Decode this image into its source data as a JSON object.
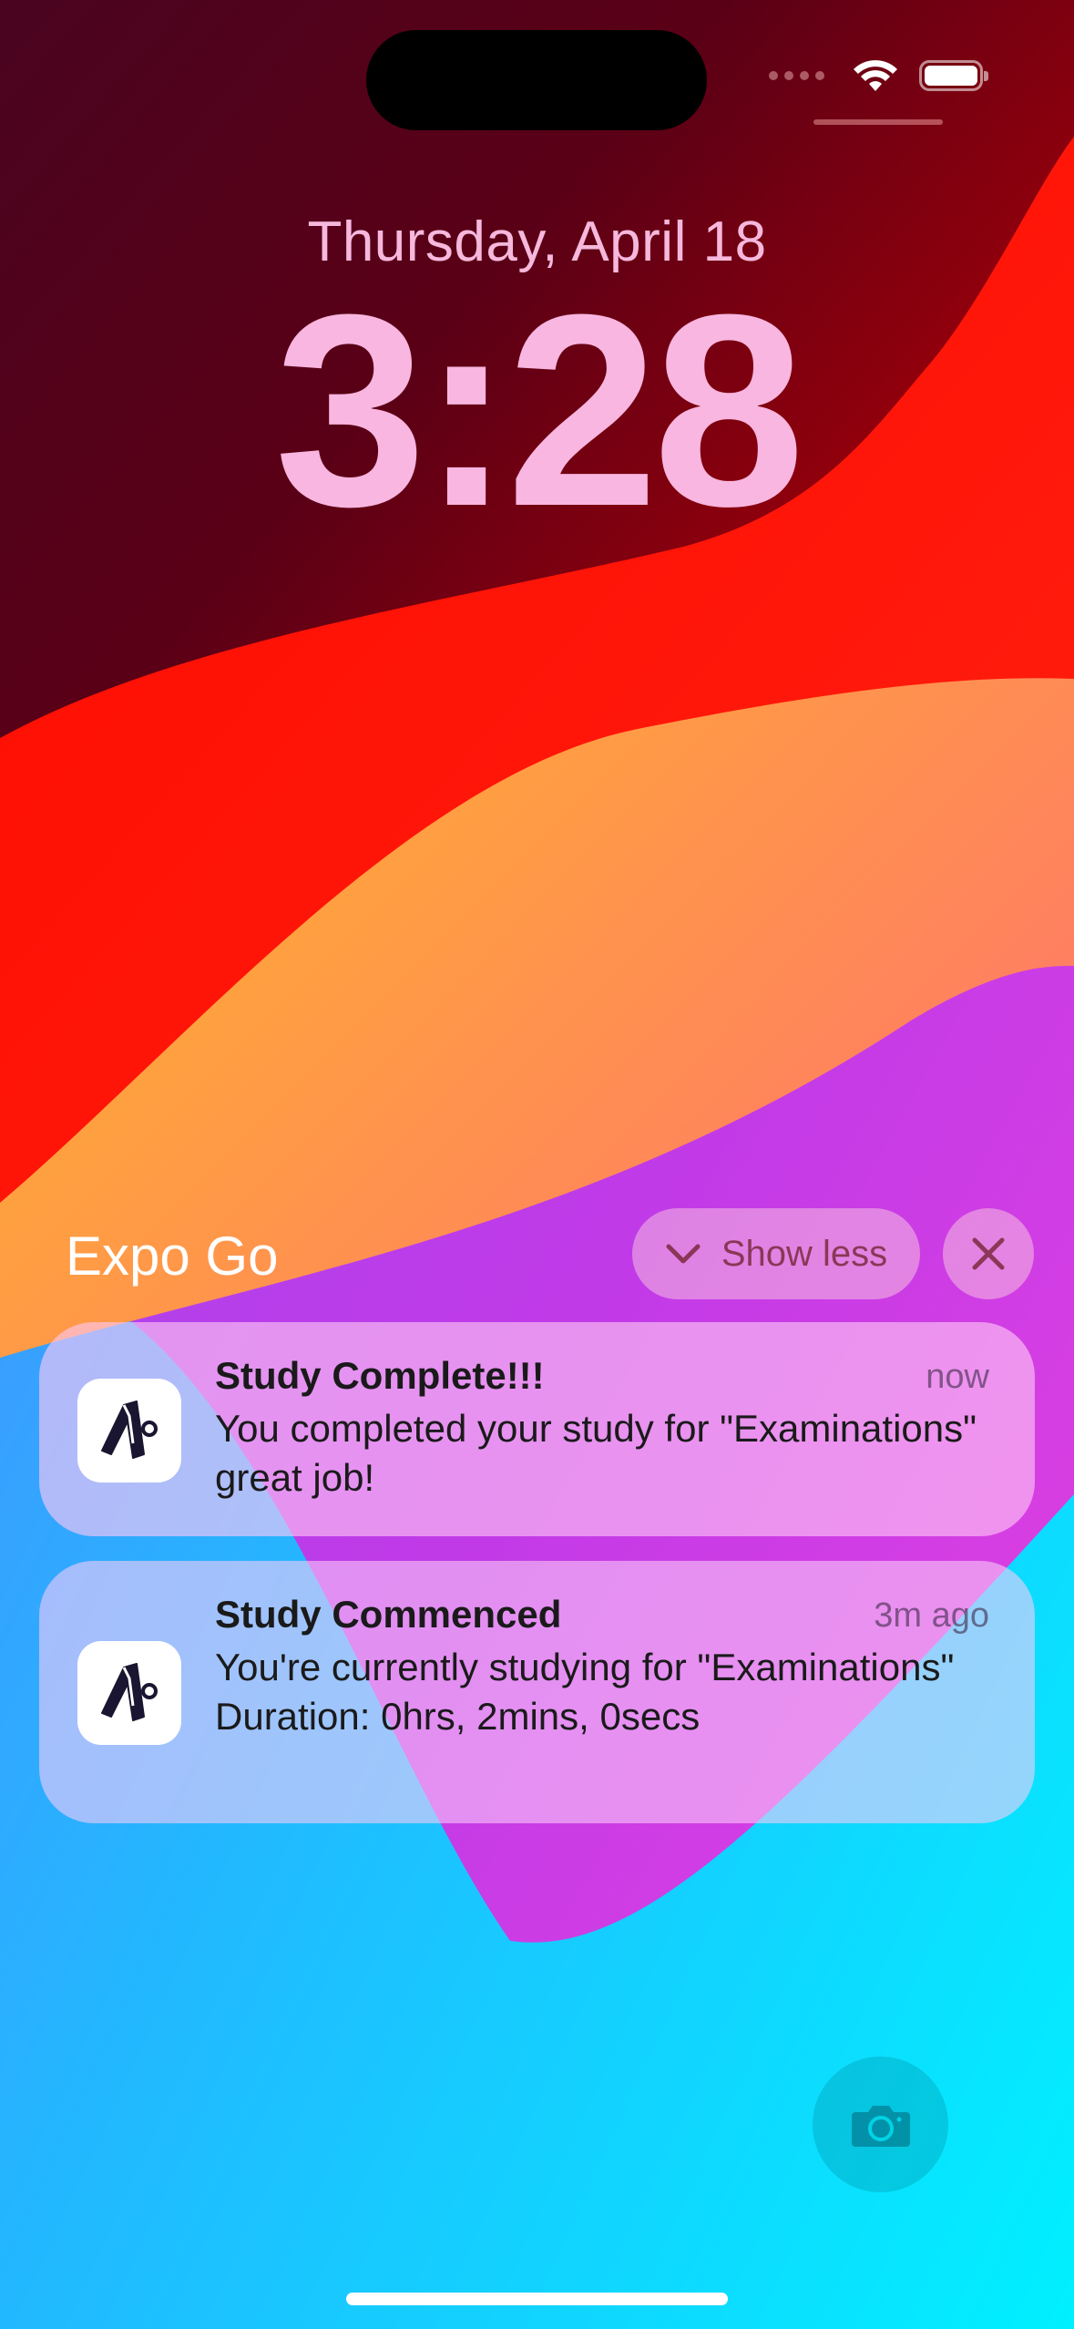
{
  "lock_screen": {
    "date": "Thursday, April 18",
    "time": "3:28"
  },
  "status_bar": {
    "icons": [
      "cellular-signal-icon",
      "wifi-icon",
      "battery-icon"
    ]
  },
  "notification_group": {
    "app_name": "Expo Go",
    "show_less_label": "Show less",
    "notifications": [
      {
        "title": "Study Complete!!!",
        "time": "now",
        "body": "You completed your study for \"Examinations\" great job!",
        "icon": "app-logo-icon"
      },
      {
        "title": "Study Commenced",
        "time": "3m ago",
        "body": "You're currently studying for \"Examinations\" Duration: 0hrs, 2mins, 0secs",
        "icon": "app-logo-icon"
      }
    ]
  },
  "quick_actions": {
    "camera_icon": "camera-icon"
  },
  "colors": {
    "time_text": "#f8b6e0",
    "notification_background": "#ffc8f5"
  }
}
